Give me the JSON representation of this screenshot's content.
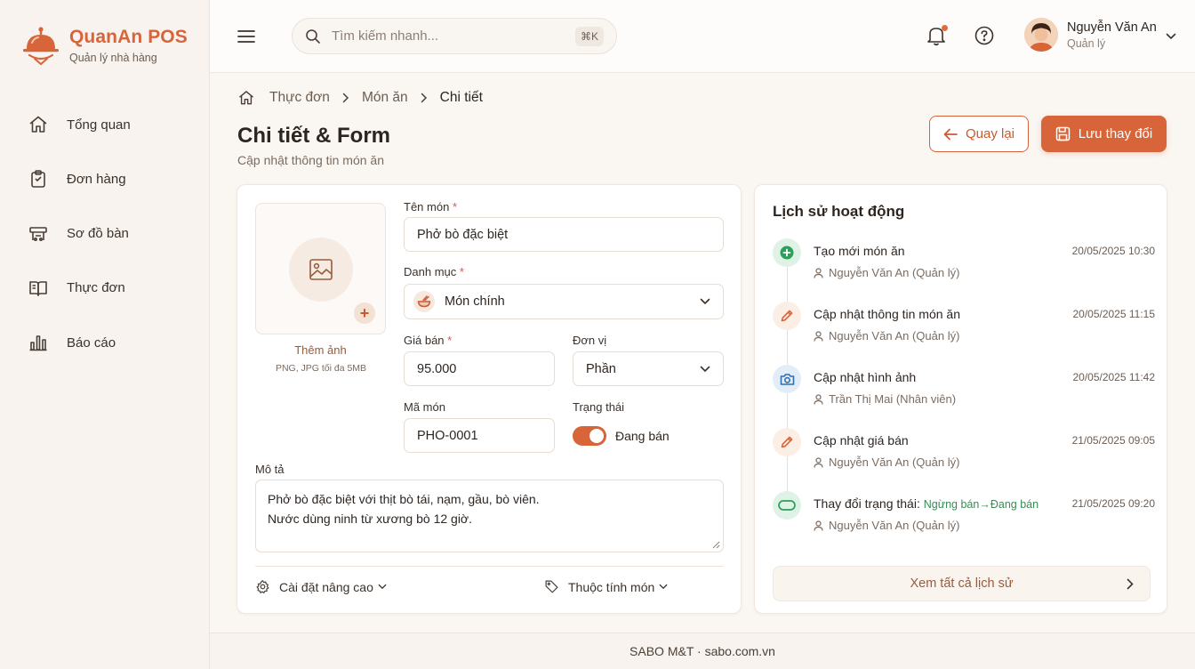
{
  "brand": {
    "name": "QuanAn POS",
    "subtitle": "Quản lý nhà hàng"
  },
  "sidebar": {
    "items": [
      {
        "label": "Tổng quan",
        "icon": "home-icon"
      },
      {
        "label": "Đơn hàng",
        "icon": "clipboard-icon"
      },
      {
        "label": "Sơ đồ bàn",
        "icon": "table-icon"
      },
      {
        "label": "Thực đơn",
        "icon": "book-icon"
      },
      {
        "label": "Báo cáo",
        "icon": "bar-chart-icon"
      }
    ]
  },
  "topbar": {
    "search_placeholder": "Tìm kiếm nhanh...",
    "shortcut": "⌘K",
    "user_name": "Nguyễn Văn An",
    "user_role": "Quản lý"
  },
  "breadcrumb": [
    "Thực đơn",
    "Món ăn",
    "Chi tiết"
  ],
  "page": {
    "title": "Chi tiết & Form",
    "subtitle": "Cập nhật thông tin món ăn"
  },
  "actions": {
    "back": "Quay lại",
    "save": "Lưu thay đổi"
  },
  "form": {
    "upload_title": "Thêm ảnh",
    "upload_hint": "PNG, JPG tối đa 5MB",
    "name_label": "Tên món",
    "name_value": "Phở bò đặc biệt",
    "category_label": "Danh mục",
    "category_value": "Món chính",
    "price_label": "Giá bán",
    "price_value": "95.000",
    "unit_label": "Đơn vị",
    "unit_value": "Phần",
    "code_label": "Mã món",
    "code_value": "PHO-0001",
    "status_label": "Trạng thái",
    "status_value": "Đang bán",
    "required_mark": "*",
    "desc_label": "Mô tả",
    "desc_line1": "Phở bò đặc biệt với thịt bò tái, nạm, gầu, bò viên.",
    "desc_line2": "Nước dùng ninh từ xương bò 12 giờ.",
    "advanced": "Cài đặt nâng cao",
    "attributes": "Thuộc tính món"
  },
  "history": {
    "title": "Lịch sử hoạt động",
    "items": [
      {
        "action": "Tạo mới món ăn",
        "user": "Nguyễn Văn An (Quản lý)",
        "time": "20/05/2025 10:30",
        "icon": "plus-circle-icon",
        "color": "#2f9e5a"
      },
      {
        "action": "Cập nhật thông tin món ăn",
        "user": "Nguyễn Văn An (Quản lý)",
        "time": "20/05/2025 11:15",
        "icon": "pencil-icon",
        "color": "#d8643a"
      },
      {
        "action": "Cập nhật hình ảnh",
        "user": "Trần Thị Mai (Nhân viên)",
        "time": "20/05/2025 11:42",
        "icon": "camera-icon",
        "color": "#2f6fb0"
      },
      {
        "action": "Cập nhật giá bán",
        "user": "Nguyễn Văn An (Quản lý)",
        "time": "21/05/2025 09:05",
        "icon": "pencil-icon",
        "color": "#d8643a"
      },
      {
        "action": "Thay đổi trạng thái:",
        "from": "Ngừng bán",
        "arrow": "→",
        "to": "Đang bán",
        "user": "Nguyễn Văn An (Quản lý)",
        "time": "21/05/2025 09:20",
        "icon": "toggle-icon",
        "color": "#2f9e5a"
      }
    ],
    "view_all": "Xem tất cả lịch sử"
  },
  "footer": "SABO M&T · sabo.com.vn"
}
